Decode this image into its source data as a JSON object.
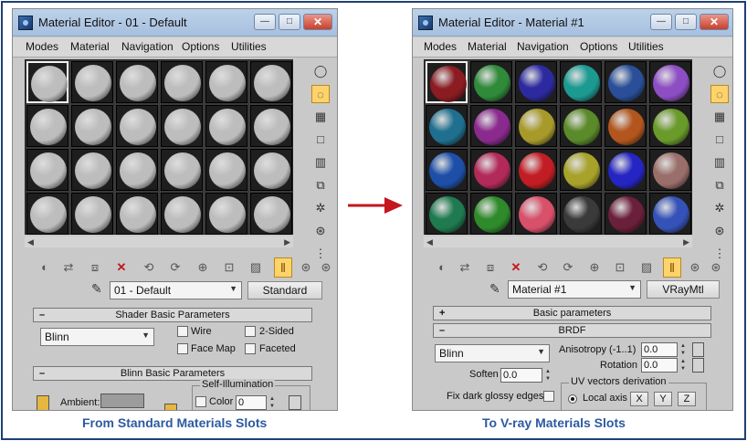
{
  "left_editor": {
    "title": "Material Editor - 01 - Default",
    "menus": [
      "Modes",
      "Material",
      "Navigation",
      "Options",
      "Utilities"
    ],
    "slot_colors": [
      "#bdbdbd",
      "#bdbdbd",
      "#bdbdbd",
      "#bdbdbd",
      "#bdbdbd",
      "#bdbdbd",
      "#bdbdbd",
      "#bdbdbd",
      "#bdbdbd",
      "#bdbdbd",
      "#bdbdbd",
      "#bdbdbd",
      "#bdbdbd",
      "#bdbdbd",
      "#bdbdbd",
      "#bdbdbd",
      "#bdbdbd",
      "#bdbdbd",
      "#bdbdbd",
      "#bdbdbd",
      "#bdbdbd",
      "#bdbdbd",
      "#bdbdbd",
      "#bdbdbd"
    ],
    "material_name": "01 - Default",
    "material_type": "Standard",
    "shader_rollout": "Shader Basic Parameters",
    "shader": "Blinn",
    "wire_label": "Wire",
    "two_sided_label": "2-Sided",
    "face_map_label": "Face Map",
    "faceted_label": "Faceted",
    "blinn_rollout": "Blinn Basic Parameters",
    "self_illum_title": "Self-Illumination",
    "ambient_label": "Ambient:",
    "color_label": "Color",
    "color_value": "0"
  },
  "right_editor": {
    "title": "Material Editor - Material #1",
    "menus": [
      "Modes",
      "Material",
      "Navigation",
      "Options",
      "Utilities"
    ],
    "slot_colors": [
      "#8a1c22",
      "#2f8a3a",
      "#2d2aa0",
      "#1c9a92",
      "#2a4f98",
      "#8d4ec4",
      "#1f6f8f",
      "#8a2a8e",
      "#a89a2a",
      "#5a8a2a",
      "#b2561e",
      "#6a9a2a",
      "#1d4fa8",
      "#b22a5a",
      "#c21d24",
      "#a7a22a",
      "#2525c4",
      "#9a6e6a",
      "#1f7a4f",
      "#2e8a2a",
      "#d8506a",
      "#3a3a3a",
      "#6a1f3a",
      "#3552b8"
    ],
    "material_name": "Material #1",
    "material_type": "VRayMtl",
    "basic_rollout": "Basic parameters",
    "brdf_rollout": "BRDF",
    "brdf_type": "Blinn",
    "anisotropy_label": "Anisotropy (-1..1)",
    "anisotropy_value": "0.0",
    "rotation_label": "Rotation",
    "rotation_value": "0.0",
    "soften_label": "Soften",
    "soften_value": "0.0",
    "uv_title": "UV vectors derivation",
    "fix_glossy_label": "Fix dark glossy edges",
    "local_axis_label": "Local axis",
    "axes": [
      "X",
      "Y",
      "Z"
    ]
  },
  "captions": {
    "left": "From Standard Materials Slots",
    "right": "To V-ray Materials Slots"
  },
  "colors": {
    "caption": "#2c5aa0",
    "arrow": "#c4161c",
    "frame": "#1e3f73"
  }
}
